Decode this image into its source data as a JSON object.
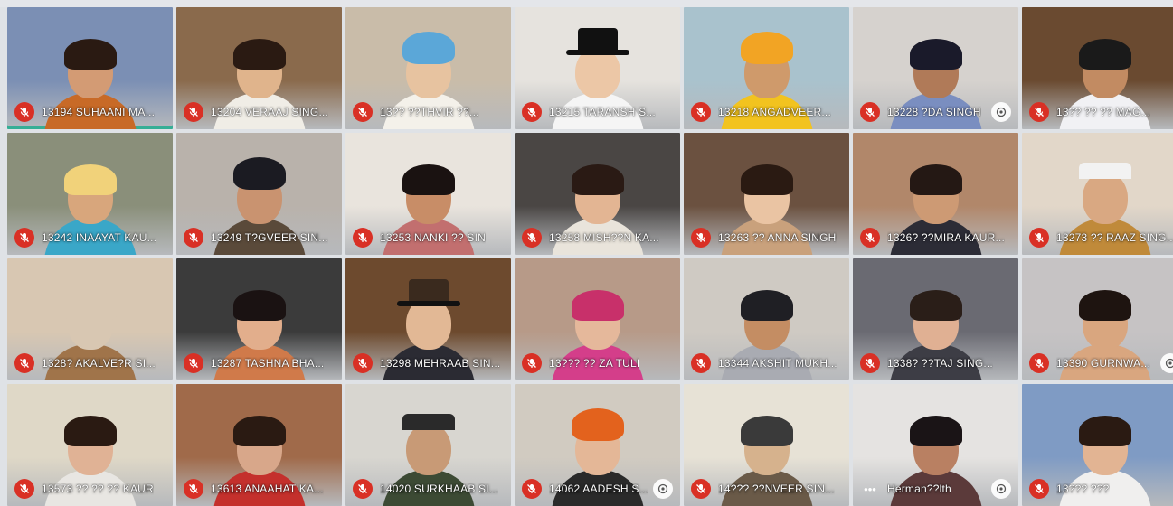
{
  "window": {
    "background": "#dfe2e6"
  },
  "tiles": [
    {
      "label": "13194 SUHAANI MA...",
      "mic": "muted",
      "speaking": true,
      "wall": "#7b8fb4",
      "skin": "#d39b74",
      "hair": "#2a1a12",
      "body": "#c86a27",
      "hat": "none",
      "pin": false
    },
    {
      "label": "13204 VERAAJ SING...",
      "mic": "muted",
      "speaking": false,
      "wall": "#8a6a4c",
      "skin": "#e0b48c",
      "hair": "#2a1a12",
      "body": "#f0ede6",
      "hat": "none",
      "pin": false
    },
    {
      "label": "13?? ??THVIR ??...",
      "mic": "muted",
      "speaking": false,
      "wall": "#c9bca9",
      "skin": "#e7c3a0",
      "hair": "#5ba7d8",
      "body": "#f4f1ea",
      "hat": "turban",
      "pin": false
    },
    {
      "label": "13215 TARANSH S...",
      "mic": "muted",
      "speaking": false,
      "wall": "#e6e3de",
      "skin": "#ecc7a6",
      "hair": "#111111",
      "body": "#f5f5f5",
      "hat": "top",
      "pin": false
    },
    {
      "label": "13218 ANGADVEER...",
      "mic": "muted",
      "speaking": false,
      "wall": "#a9c2cd",
      "skin": "#cf9a6b",
      "hair": "#f2a424",
      "body": "#f2c31f",
      "hat": "turban",
      "pin": false
    },
    {
      "label": "13228 ?DA SINGH",
      "mic": "muted",
      "speaking": false,
      "wall": "#d6d2ce",
      "skin": "#b07a58",
      "hair": "#1a1a2a",
      "body": "#7a8ec0",
      "hat": "none",
      "pin": true
    },
    {
      "label": "13?? ?? ?? MAG...",
      "mic": "muted",
      "speaking": false,
      "wall": "#6a4a30",
      "skin": "#c28b62",
      "hair": "#1a1a1a",
      "body": "#f1f1f4",
      "hat": "none",
      "pin": false
    },
    {
      "label": "13242 INAAYAT KAU...",
      "mic": "muted",
      "speaking": false,
      "wall": "#8a8f7a",
      "skin": "#d8a67c",
      "hair": "#f1d27a",
      "body": "#3aa7c8",
      "hat": "none",
      "pin": false
    },
    {
      "label": "13249 T?GVEER SIN...",
      "mic": "muted",
      "speaking": false,
      "wall": "#b9b2ab",
      "skin": "#c99370",
      "hair": "#1b1b22",
      "body": "#5a4a3a",
      "hat": "turban",
      "pin": false
    },
    {
      "label": "13253 NANKI ?? SIN",
      "mic": "muted",
      "speaking": false,
      "wall": "#e9e4dd",
      "skin": "#c88d67",
      "hair": "#1a1211",
      "body": "#c26f6f",
      "hat": "none",
      "pin": false
    },
    {
      "label": "13258 MISH??N KA...",
      "mic": "muted",
      "speaking": false,
      "wall": "#4a4644",
      "skin": "#e3b593",
      "hair": "#2a1a14",
      "body": "#e9e4db",
      "hat": "none",
      "pin": false
    },
    {
      "label": "13263 ?? ANNA SINGH",
      "mic": "muted",
      "speaking": false,
      "wall": "#6b5140",
      "skin": "#eac4a3",
      "hair": "#2a1a12",
      "body": "#c9a17c",
      "hat": "none",
      "pin": false
    },
    {
      "label": "1326? ??MIRA KAUR...",
      "mic": "muted",
      "speaking": false,
      "wall": "#b1876a",
      "skin": "#cd9a74",
      "hair": "#241814",
      "body": "#2c2c36",
      "hat": "none",
      "pin": false
    },
    {
      "label": "13273 ?? RAAZ SING...",
      "mic": "muted",
      "speaking": false,
      "wall": "#e2d7c9",
      "skin": "#d9a882",
      "hair": "#f2f2f2",
      "body": "#c08a3a",
      "hat": "cap",
      "pin": false
    },
    {
      "label": "1328? AKALVE?R SI...",
      "mic": "muted",
      "speaking": false,
      "wall": "#d8c7b2",
      "skin": "#d8c7b2",
      "hair": "#d8c7b2",
      "body": "#a0744a",
      "hat": "none",
      "pin": false
    },
    {
      "label": "13287 TASHNA BHA...",
      "mic": "muted",
      "speaking": false,
      "wall": "#3b3b3b",
      "skin": "#e2ae8c",
      "hair": "#1a1212",
      "body": "#d07a4a",
      "hat": "none",
      "pin": false
    },
    {
      "label": "13298 MEHRAAB SIN...",
      "mic": "muted",
      "speaking": false,
      "wall": "#6d4a2e",
      "skin": "#e2b895",
      "hair": "#3a2a1e",
      "body": "#2b2b33",
      "hat": "top",
      "pin": false
    },
    {
      "label": "13??? ?? ZA TULI",
      "mic": "muted",
      "speaking": false,
      "wall": "#b79a88",
      "skin": "#e5b89b",
      "hair": "#c8306a",
      "body": "#d43e8a",
      "hat": "none",
      "pin": false
    },
    {
      "label": "13344 AKSHIT MUKH...",
      "mic": "muted",
      "speaking": false,
      "wall": "#cfcac3",
      "skin": "#c48d63",
      "hair": "#1f1f24",
      "body": "#a9abb2",
      "hat": "none",
      "pin": false
    },
    {
      "label": "1338? ??TAJ SING...",
      "mic": "muted",
      "speaking": false,
      "wall": "#6a6a72",
      "skin": "#e0b093",
      "hair": "#2a1e18",
      "body": "#3d3d45",
      "hat": "none",
      "pin": false
    },
    {
      "label": "13390 GURNWA...",
      "mic": "muted",
      "speaking": false,
      "wall": "#c6c3c4",
      "skin": "#d9a67f",
      "hair": "#1e1410",
      "body": "#d9a67f",
      "hat": "none",
      "pin": true
    },
    {
      "label": "13573 ?? ?? ?? KAUR",
      "mic": "muted",
      "speaking": false,
      "wall": "#dfd8c7",
      "skin": "#e0b295",
      "hair": "#2a1a12",
      "body": "#e8e6e2",
      "hat": "none",
      "pin": false
    },
    {
      "label": "13613 ANAAHAT KA...",
      "mic": "muted",
      "speaking": false,
      "wall": "#a06a4a",
      "skin": "#d8a78a",
      "hair": "#2a1a12",
      "body": "#c4302c",
      "hat": "none",
      "pin": false
    },
    {
      "label": "14020 SURKHAAB SI...",
      "mic": "muted",
      "speaking": false,
      "wall": "#d8d6d0",
      "skin": "#c89a76",
      "hair": "#2a2a2a",
      "body": "#3c4a34",
      "hat": "cap",
      "pin": false
    },
    {
      "label": "14062 AADESH S...",
      "mic": "muted",
      "speaking": false,
      "wall": "#d1cbc1",
      "skin": "#e4b797",
      "hair": "#e3621d",
      "body": "#2a2a2a",
      "hat": "turban",
      "pin": true
    },
    {
      "label": "14??? ??NVEER SIN...",
      "mic": "muted",
      "speaking": false,
      "wall": "#e7e2d6",
      "skin": "#d6b28d",
      "hair": "#3a3a3a",
      "body": "#6a5a48",
      "hat": "none",
      "pin": false
    },
    {
      "label": "Herman??lth",
      "mic": "more",
      "speaking": false,
      "wall": "#e5e3e1",
      "skin": "#b98062",
      "hair": "#1a1416",
      "body": "#5b3a3a",
      "hat": "none",
      "pin": true
    },
    {
      "label": "13??? ???",
      "mic": "muted",
      "speaking": false,
      "wall": "#7f9bc4",
      "skin": "#e2b493",
      "hair": "#2a1a12",
      "body": "#f0efee",
      "hat": "none",
      "pin": false
    }
  ]
}
